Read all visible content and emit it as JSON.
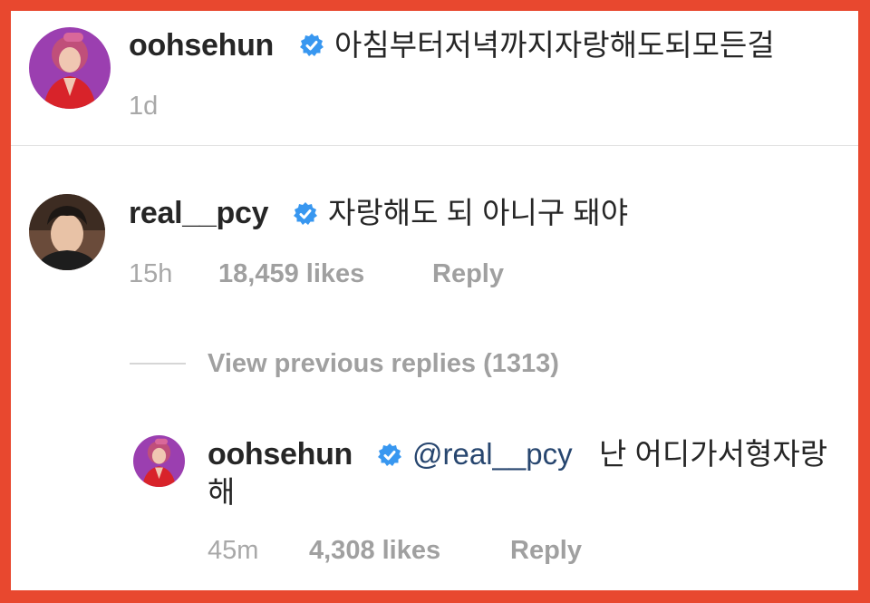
{
  "colors": {
    "frame_border": "#e8482f",
    "username": "#262626",
    "text": "#262626",
    "meta": "#a8a8a8",
    "mention": "#27466f",
    "verified_badge": "#3897f0"
  },
  "icons": {
    "verified": "verified-badge-icon"
  },
  "comments": [
    {
      "username": "oohsehun",
      "verified": true,
      "text": "아침부터저녁까지자랑해도되모든걸",
      "time": "1d"
    },
    {
      "username": "real__pcy",
      "verified": true,
      "text": "자랑해도 되 아니구 돼야",
      "time": "15h",
      "likes": "18,459 likes",
      "reply_label": "Reply"
    }
  ],
  "view_replies": {
    "label": "View previous replies (1313)"
  },
  "reply": {
    "username": "oohsehun",
    "verified": true,
    "mention": "@real__pcy",
    "text_line1": "난 어디가서형자랑",
    "text_line2": "해",
    "time": "45m",
    "likes": "4,308 likes",
    "reply_label": "Reply"
  }
}
